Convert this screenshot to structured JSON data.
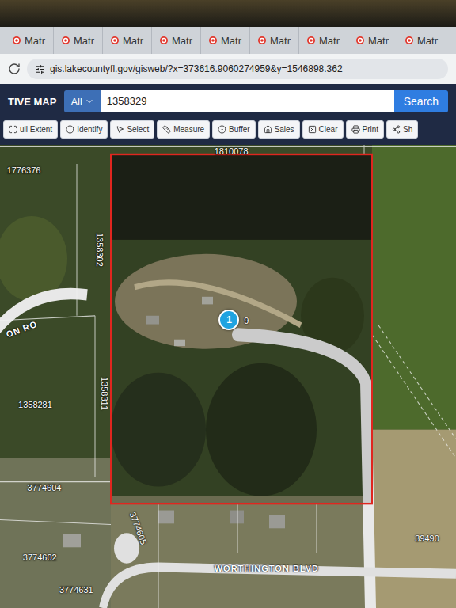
{
  "browser": {
    "tabs": [
      {
        "label": "Matr",
        "selected": false
      },
      {
        "label": "Matr",
        "selected": false
      },
      {
        "label": "Matr",
        "selected": false
      },
      {
        "label": "Matr",
        "selected": false
      },
      {
        "label": "Matr",
        "selected": false
      },
      {
        "label": "Matr",
        "selected": false
      },
      {
        "label": "Matr",
        "selected": false
      },
      {
        "label": "Matr",
        "selected": false
      },
      {
        "label": "Matr",
        "selected": false
      }
    ],
    "address": "gis.lakecountyfl.gov/gisweb/?x=373616.9060274959&y=1546898.362"
  },
  "app": {
    "title": "TIVE MAP",
    "search": {
      "filter": "All",
      "value": "1358329",
      "button": "Search"
    },
    "tools": [
      {
        "label": "ull Extent",
        "kind": "extent"
      },
      {
        "label": "Identify",
        "kind": "identify"
      },
      {
        "label": "Select",
        "kind": "select"
      },
      {
        "label": "Measure",
        "kind": "measure"
      },
      {
        "label": "Buffer",
        "kind": "buffer"
      },
      {
        "label": "Sales",
        "kind": "sales"
      },
      {
        "label": "Clear",
        "kind": "clear"
      },
      {
        "label": "Print",
        "kind": "print"
      },
      {
        "label": "Sh",
        "kind": "share"
      }
    ]
  },
  "map": {
    "parcel_labels": [
      {
        "text": "1810078"
      },
      {
        "text": "1776376"
      },
      {
        "text": "1358302"
      },
      {
        "text": "1358311"
      },
      {
        "text": "1358281"
      },
      {
        "text": "3774604"
      },
      {
        "text": "3774605"
      },
      {
        "text": "3774602"
      },
      {
        "text": "3774631"
      },
      {
        "text": "39490"
      }
    ],
    "road_labels": [
      {
        "text": "WORTHINGTON BLVD"
      },
      {
        "text": "ON RO"
      }
    ],
    "pin": {
      "label": "1"
    },
    "selected_parcel_label_fragment": "9"
  }
}
